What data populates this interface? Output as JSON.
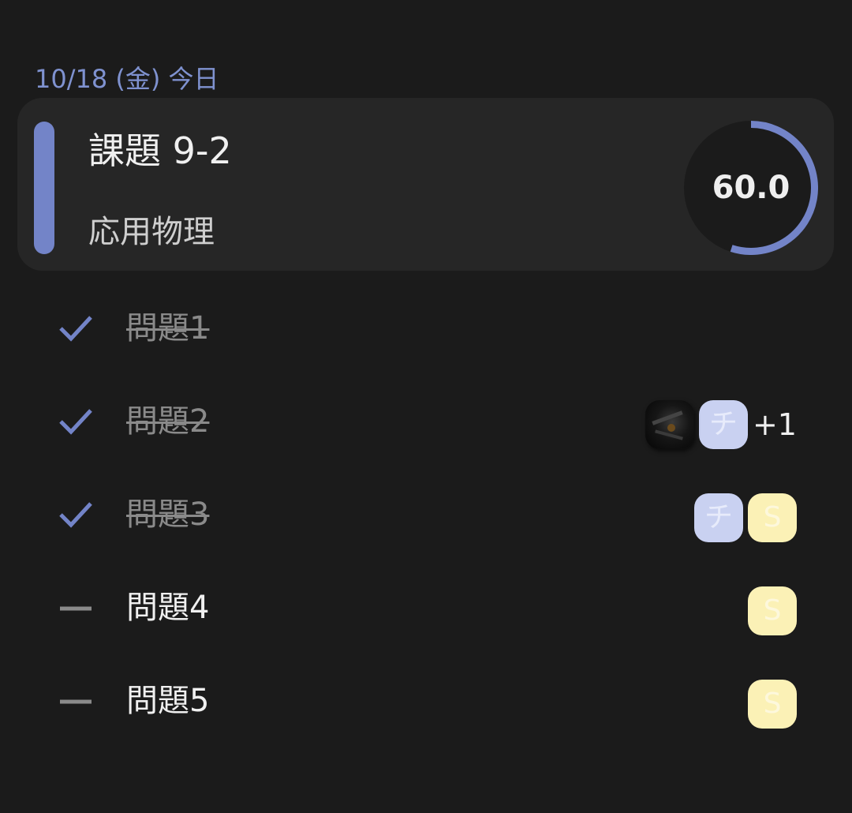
{
  "date_header": "10/18 (金) 今日",
  "task": {
    "title": "課題 9-2",
    "subject": "応用物理",
    "progress_display": "60.0",
    "progress_fraction": 0.55,
    "accent_color": "#7384c8"
  },
  "subtasks": [
    {
      "label": "問題1",
      "status": "done",
      "status_icon": "check-icon",
      "assignees": []
    },
    {
      "label": "問題2",
      "status": "done",
      "status_icon": "check-icon",
      "assignees": [
        {
          "type": "photo",
          "name": "photo-avatar"
        },
        {
          "type": "initial",
          "initial": "チ",
          "color": "#c9d1f1"
        }
      ],
      "more": "+1"
    },
    {
      "label": "問題3",
      "status": "done",
      "status_icon": "check-icon",
      "assignees": [
        {
          "type": "initial",
          "initial": "チ",
          "color": "#c9d1f1"
        },
        {
          "type": "initial",
          "initial": "S",
          "color": "#fbf1b6"
        }
      ]
    },
    {
      "label": "問題4",
      "status": "todo",
      "status_icon": "dash-icon",
      "assignees": [
        {
          "type": "initial",
          "initial": "S",
          "color": "#fbf1b6"
        }
      ]
    },
    {
      "label": "問題5",
      "status": "todo",
      "status_icon": "dash-icon",
      "assignees": [
        {
          "type": "initial",
          "initial": "S",
          "color": "#fbf1b6"
        }
      ]
    }
  ],
  "colors": {
    "background": "#1b1b1b",
    "card": "#262626",
    "accent": "#7384c8",
    "date_text": "#7f92d0",
    "done_text": "#8a8a8a"
  }
}
